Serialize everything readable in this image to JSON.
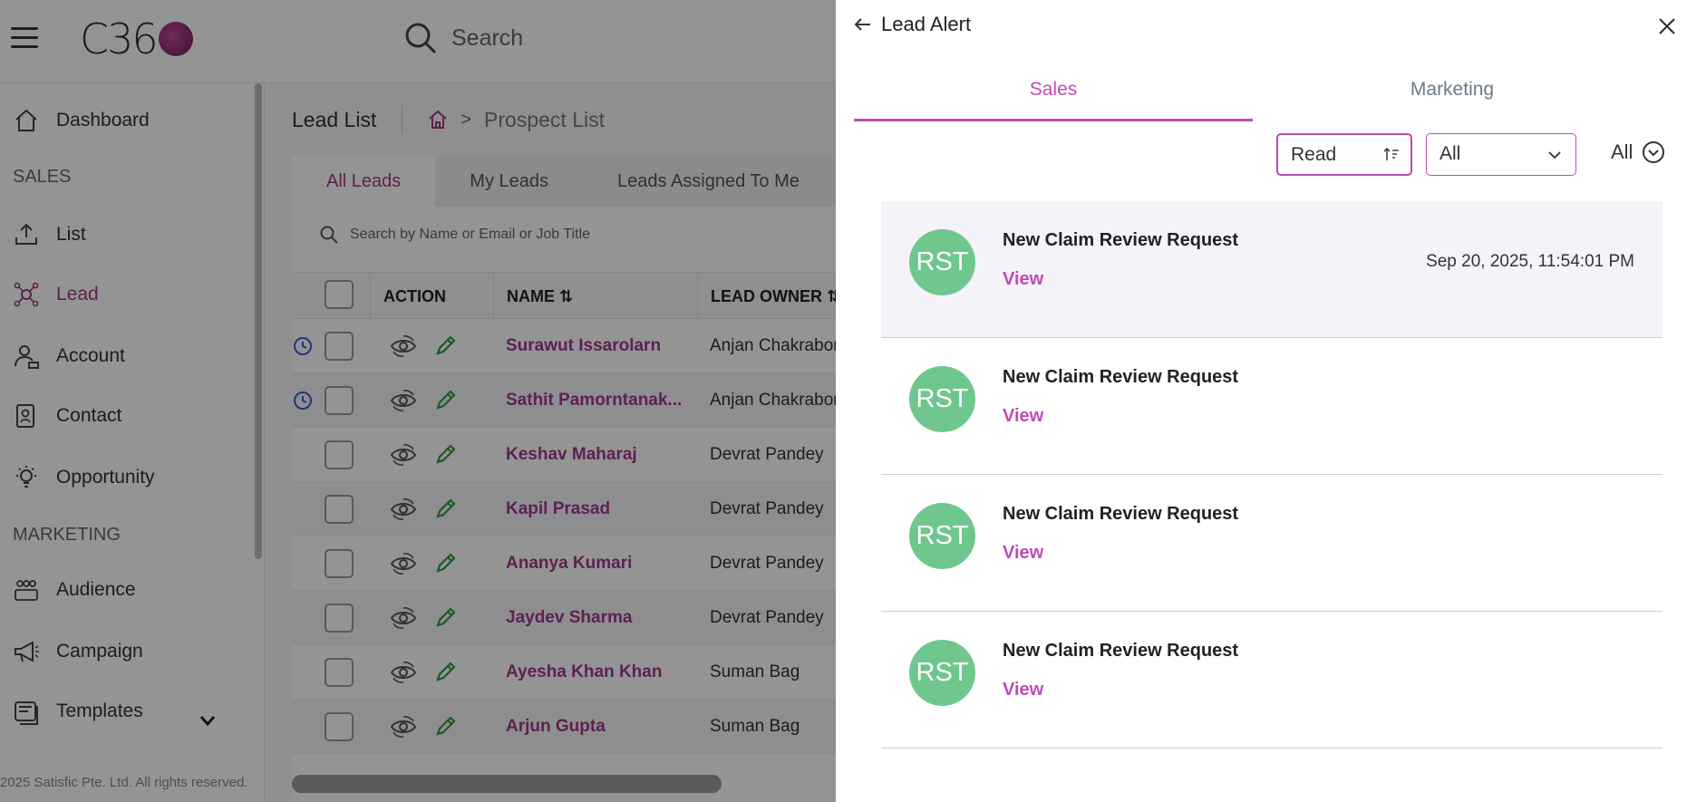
{
  "header": {
    "logo_text": "C36",
    "search_label": "Search"
  },
  "sidebar": {
    "items": [
      {
        "label": "Dashboard",
        "icon": "home-icon"
      },
      {
        "label": "List",
        "icon": "upload-icon"
      },
      {
        "label": "Lead",
        "icon": "network-icon"
      },
      {
        "label": "Account",
        "icon": "account-icon"
      },
      {
        "label": "Contact",
        "icon": "contact-icon"
      },
      {
        "label": "Opportunity",
        "icon": "bulb-icon"
      },
      {
        "label": "Audience",
        "icon": "audience-icon"
      },
      {
        "label": "Campaign",
        "icon": "megaphone-icon"
      },
      {
        "label": "Templates",
        "icon": "templates-icon"
      }
    ],
    "sections": {
      "sales": "SALES",
      "marketing": "MARKETING"
    },
    "copyright": "2025 Satisfic Pte. Ltd. All rights reserved."
  },
  "content": {
    "page_title": "Lead List",
    "breadcrumb_current": "Prospect List",
    "tabs": [
      "All Leads",
      "My Leads",
      "Leads Assigned To Me"
    ],
    "search_placeholder": "Search by Name or Email or Job Title",
    "columns": {
      "action": "ACTION",
      "name": "NAME ⇅",
      "owner": "LEAD OWNER ⇅"
    },
    "rows": [
      {
        "name": "Surawut Issarolarn",
        "owner": "Anjan Chakrabor"
      },
      {
        "name": "Sathit Pamorntanak...",
        "owner": "Anjan Chakrabor"
      },
      {
        "name": "Keshav Maharaj",
        "owner": "Devrat Pandey"
      },
      {
        "name": "Kapil Prasad",
        "owner": "Devrat Pandey"
      },
      {
        "name": "Ananya Kumari",
        "owner": "Devrat Pandey"
      },
      {
        "name": "Jaydev Sharma",
        "owner": "Devrat Pandey"
      },
      {
        "name": "Ayesha Khan Khan",
        "owner": "Suman Bag"
      },
      {
        "name": "Arjun Gupta",
        "owner": "Suman Bag"
      }
    ]
  },
  "panel": {
    "title": "Lead Alert",
    "tabs": {
      "sales": "Sales",
      "marketing": "Marketing"
    },
    "filters": {
      "read": "Read",
      "type": "All",
      "toggle": "All"
    },
    "notifications": [
      {
        "initials": "RST",
        "title": "New Claim Review Request",
        "action": "View",
        "time": "Sep 20, 2025, 11:54:01 PM"
      },
      {
        "initials": "RST",
        "title": "New Claim Review Request",
        "action": "View",
        "time": ""
      },
      {
        "initials": "RST",
        "title": "New Claim Review Request",
        "action": "View",
        "time": ""
      },
      {
        "initials": "RST",
        "title": "New Claim Review Request",
        "action": "View",
        "time": ""
      }
    ],
    "accent_color": "#c04ab4",
    "avatar_color": "#6fc78e"
  }
}
